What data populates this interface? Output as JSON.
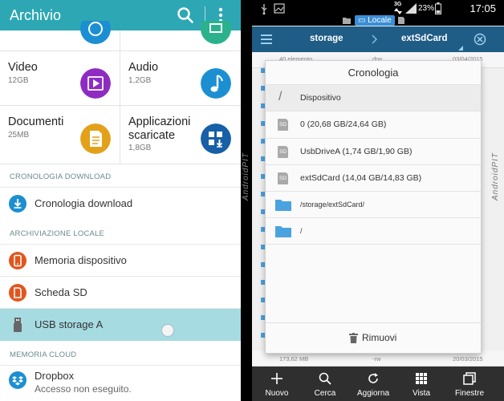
{
  "left": {
    "app_title": "Archivio",
    "tiles": [
      {
        "name": "Video",
        "size": "12GB",
        "icon": "video-icon",
        "color": "#8e2cc2"
      },
      {
        "name": "Audio",
        "size": "1,2GB",
        "icon": "music-note-icon",
        "color": "#1c8fd2"
      },
      {
        "name": "Documenti",
        "size": "25MB",
        "icon": "document-icon",
        "color": "#e3a11a"
      },
      {
        "name": "Applicazioni scaricate",
        "size": "1,8GB",
        "icon": "download-apps-icon",
        "color": "#175fa6"
      }
    ],
    "sections": {
      "download": "CRONOLOGIA DOWNLOAD",
      "local": "ARCHIVIAZIONE LOCALE",
      "cloud": "MEMORIA CLOUD"
    },
    "rows": {
      "download_history": "Cronologia download",
      "device_memory": "Memoria dispositivo",
      "sd_card": "Scheda SD",
      "usb_storage": "USB storage A"
    },
    "dropbox": {
      "name": "Dropbox",
      "status": "Accesso non eseguito."
    },
    "accent": "#2ea7b4",
    "selected_color": "#a6dbe2"
  },
  "watermark": "AndroidPIT",
  "right": {
    "status": {
      "network": "3G",
      "battery": "23%",
      "time": "17:05"
    },
    "locale_label": "Locale",
    "toolbar": {
      "path_1": "storage",
      "path_2": "extSdCard"
    },
    "file_meta": {
      "top_count": "40 elemento",
      "top_perm": "drw",
      "top_date": "03/04/2015",
      "bottom_size": "173,62 MB",
      "bottom_perm": "-rw",
      "bottom_date": "20/03/2015"
    },
    "dialog": {
      "title": "Cronologia",
      "items": [
        {
          "label": "Dispositivo",
          "icon": "slash-icon"
        },
        {
          "label": "0 (20,68 GB/24,64 GB)",
          "icon": "sd-card-icon"
        },
        {
          "label": "UsbDriveA (1,74 GB/1,90 GB)",
          "icon": "sd-card-icon"
        },
        {
          "label": "extSdCard (14,04 GB/14,83 GB)",
          "icon": "sd-card-icon"
        },
        {
          "label": "/storage/extSdCard/",
          "icon": "folder-icon"
        },
        {
          "label": "/",
          "icon": "folder-icon"
        }
      ],
      "remove_label": "Rimuovi"
    },
    "bottom_bar": [
      {
        "label": "Nuovo",
        "icon": "plus-icon"
      },
      {
        "label": "Cerca",
        "icon": "search-icon"
      },
      {
        "label": "Aggiorna",
        "icon": "refresh-icon"
      },
      {
        "label": "Vista",
        "icon": "grid-icon"
      },
      {
        "label": "Finestre",
        "icon": "windows-icon"
      }
    ],
    "toolbar_color": "#1f5c86"
  }
}
